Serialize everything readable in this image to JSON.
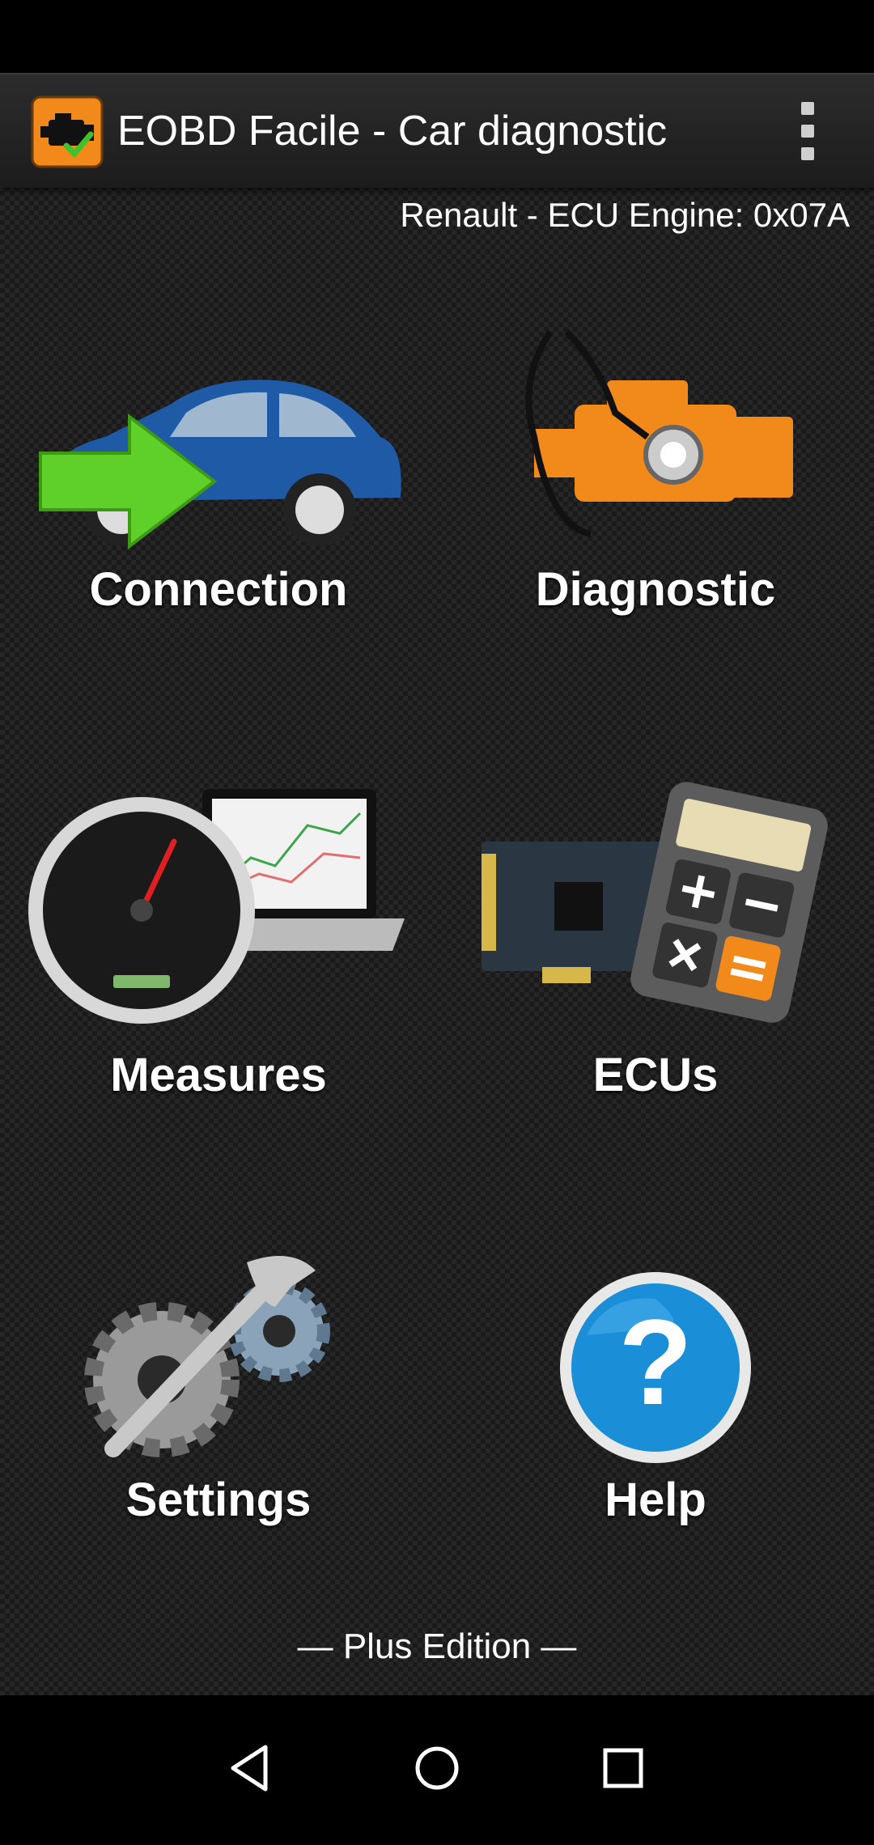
{
  "app_bar": {
    "title": "EOBD Facile - Car diagnostic",
    "icon": "engine-check-icon",
    "menu_icon": "overflow-menu-icon"
  },
  "status": {
    "ecu_info": "Renault - ECU Engine: 0x07A"
  },
  "menu": {
    "connection": {
      "label": "Connection",
      "icon": "car-connect-icon"
    },
    "diagnostic": {
      "label": "Diagnostic",
      "icon": "engine-stethoscope-icon"
    },
    "measures": {
      "label": "Measures",
      "icon": "speedometer-laptop-icon"
    },
    "ecus": {
      "label": "ECUs",
      "icon": "circuit-calculator-icon"
    },
    "settings": {
      "label": "Settings",
      "icon": "gears-wrench-icon"
    },
    "help": {
      "label": "Help",
      "icon": "question-mark-icon"
    }
  },
  "footer": {
    "edition": "— Plus Edition —"
  },
  "nav": {
    "back_icon": "back-triangle-icon",
    "home_icon": "home-circle-icon",
    "recents_icon": "recents-square-icon"
  },
  "colors": {
    "accent_orange": "#f28a1b",
    "help_blue": "#1a8fd8",
    "car_blue": "#1f5aa6",
    "arrow_green": "#5fd02a"
  }
}
